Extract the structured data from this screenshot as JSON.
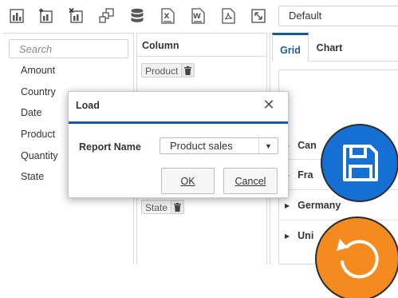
{
  "toolbar": {
    "icons": [
      "bar-chart-icon",
      "add-measure-icon",
      "remove-measure-icon",
      "pivot-layout-icon",
      "database-icon",
      "export-excel-icon",
      "export-word-icon",
      "export-pdf-icon",
      "fullscreen-icon"
    ],
    "report_select_value": "Default"
  },
  "field_list": {
    "search_placeholder": "Search",
    "items": [
      "Amount",
      "Country",
      "Date",
      "Product",
      "Quantity",
      "State"
    ]
  },
  "columns_panel": {
    "header": "Column",
    "chips": [
      "Product",
      "State"
    ]
  },
  "grid_panel": {
    "tabs": [
      "Grid",
      "Chart"
    ],
    "active_tab": "Grid",
    "rows": [
      "Can",
      "Fra",
      "Germany",
      "Uni"
    ]
  },
  "dialog": {
    "title": "Load",
    "close_icon": "close-icon",
    "field_label": "Report Name",
    "select_value": "Product sales",
    "ok_label": "OK",
    "cancel_label": "Cancel"
  },
  "badges": {
    "save_icon": "floppy-disk-icon",
    "save_color": "#1670d4",
    "reload_icon": "refresh-icon",
    "reload_color": "#f58a1f"
  },
  "colors": {
    "accent": "#1a5a96"
  }
}
